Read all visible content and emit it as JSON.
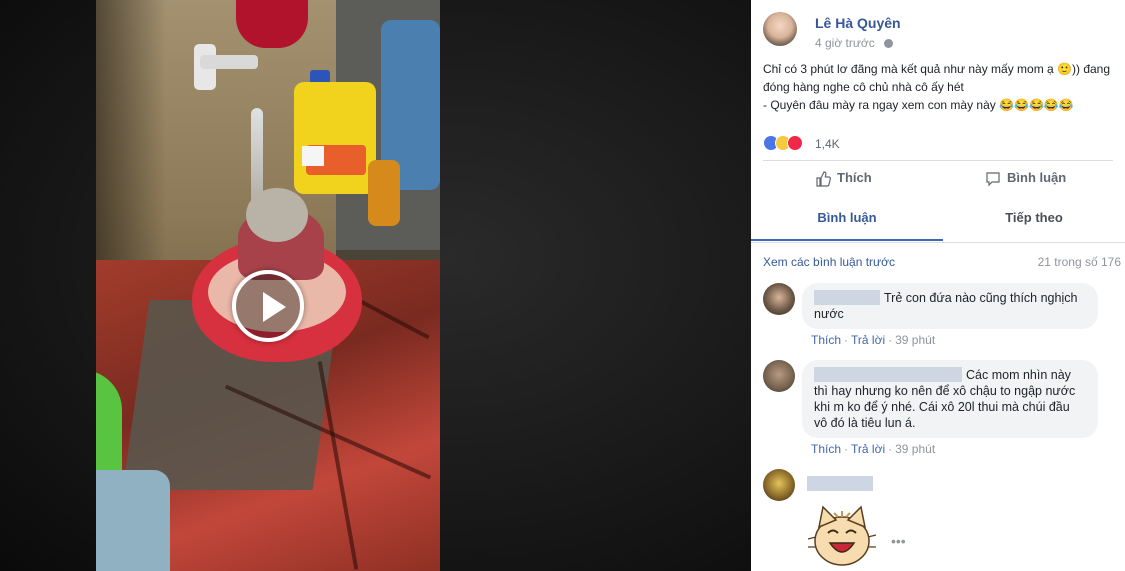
{
  "post": {
    "author_name": "Lê Hà Quyên",
    "time": "4 giờ trước",
    "text_line1": "Chỉ có 3 phút lơ đãng mà kết quả như này mấy mom ạ 🙂)) đang",
    "text_line2": "đóng hàng nghe cô chủ nhà cô ấy hét",
    "text_line3": "- Quyên đâu mày ra ngay xem con mày này 😂😂😂😂😂",
    "reaction_count": "1,4K"
  },
  "actions": {
    "like_label": "Thích",
    "comment_label": "Bình luận"
  },
  "tabs": {
    "comments": "Bình luận",
    "next": "Tiếp theo"
  },
  "comments_section": {
    "view_previous": "Xem các bình luận trước",
    "count_label": "21 trong số 176",
    "items": [
      {
        "text": "Trẻ con đứa nào cũng thích nghịch nước",
        "like": "Thích",
        "reply": "Trả lời",
        "time": "39 phút"
      },
      {
        "text": "Các mom nhìn này thì hay nhưng ko nên để xô chậu to ngập nước khi m ko để ý nhé. Cái xô 20l thui mà chúi đầu vô đó là tiêu lun á.",
        "like": "Thích",
        "reply": "Trả lời",
        "time": "39 phút"
      }
    ],
    "more": "•••"
  },
  "colors": {
    "link_blue": "#365899",
    "action_blue": "#4267b2",
    "bubble_gray": "#f2f3f5"
  }
}
